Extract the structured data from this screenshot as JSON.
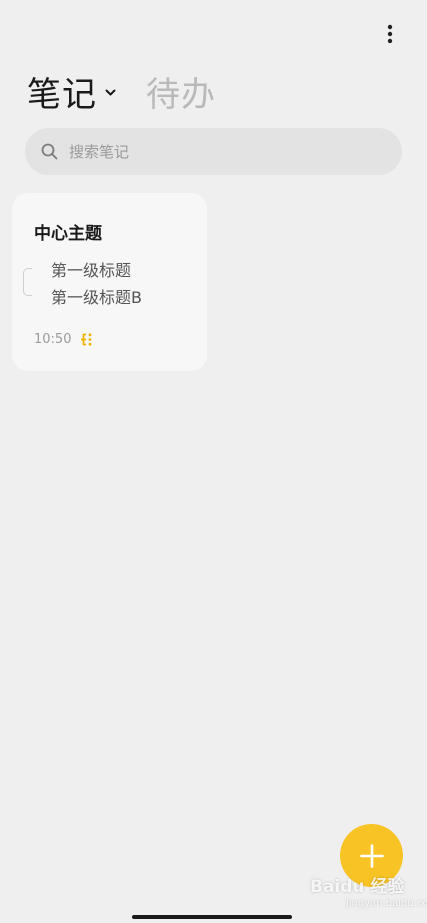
{
  "header": {
    "more_icon": "more-vertical-icon",
    "tabs": [
      {
        "label": "笔记",
        "active": true,
        "icon": "chevron-down-icon"
      },
      {
        "label": "待办",
        "active": false
      }
    ]
  },
  "search": {
    "icon": "search-icon",
    "placeholder": "搜索笔记"
  },
  "notes": [
    {
      "title": "中心主题",
      "branches": [
        "第一级标题",
        "第一级标题B"
      ],
      "time": "10:50",
      "type_icon": "mindmap-icon"
    }
  ],
  "fab": {
    "icon": "plus-icon"
  },
  "watermark": {
    "text": "Baidu 经验",
    "sub": "jingyan.baidu.com"
  },
  "colors": {
    "background": "#efefef",
    "accent": "#f7c325",
    "card": "#f7f7f7",
    "search_bg": "#e3e3e3",
    "inactive_tab": "#b9b9b9"
  }
}
